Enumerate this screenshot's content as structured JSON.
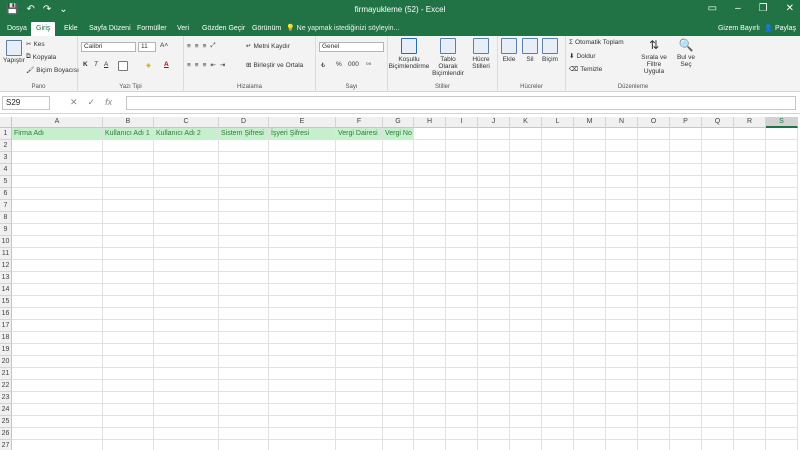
{
  "window": {
    "title": "firmayukleme (52) - Excel",
    "min": "–",
    "restore": "❐",
    "close": "✕",
    "ribbon_display": "▭"
  },
  "qat": {
    "save": "💾",
    "undo": "↶",
    "redo": "↷",
    "customize": "⌄"
  },
  "tabs": [
    "Dosya",
    "Giriş",
    "Ekle",
    "Sayfa Düzeni",
    "Formüller",
    "Veri",
    "Gözden Geçir",
    "Görünüm"
  ],
  "tell_me": "Ne yapmak istediğinizi söyleyin...",
  "user": "Gizem Bayırlı",
  "share": "Paylaş",
  "ribbon": {
    "clipboard": {
      "label": "Pano",
      "paste": "Yapıştır",
      "cut": "Kes",
      "copy": "Kopyala",
      "painter": "Biçim Boyacısı"
    },
    "font": {
      "label": "Yazı Tipi",
      "font_name": "Calibri",
      "font_size": "11",
      "bold": "K",
      "italic": "T",
      "underline": "A",
      "font_color": "A"
    },
    "alignment": {
      "label": "Hizalama",
      "wrap": "Metni Kaydır",
      "merge": "Birleştir ve Ortala"
    },
    "number": {
      "label": "Sayı",
      "format": "Genel",
      "percent": "%",
      "comma": "000"
    },
    "styles": {
      "label": "Stiller",
      "conditional": "Koşullu Biçimlendirme",
      "table": "Tablo Olarak Biçimlendir",
      "cell_styles": "Hücre Stilleri"
    },
    "cells": {
      "label": "Hücreler",
      "insert": "Ekle",
      "delete": "Sil",
      "format": "Biçim"
    },
    "editing": {
      "label": "Düzenleme",
      "autosum": "Otomatik Toplam",
      "fill": "Doldur",
      "clear": "Temizle",
      "sort": "Sırala ve Filtre Uygula",
      "find": "Bul ve Seç"
    }
  },
  "formula_bar": {
    "name_box": "S29",
    "cancel": "✕",
    "enter": "✓",
    "fx": "fx",
    "value": ""
  },
  "sheet": {
    "columns": [
      "A",
      "B",
      "C",
      "D",
      "E",
      "F",
      "G",
      "H",
      "I",
      "J",
      "K",
      "L",
      "M",
      "N",
      "O",
      "P",
      "Q",
      "R",
      "S"
    ],
    "active_column": "S",
    "row_count": 27,
    "headers": [
      "Firma Adı",
      "Kullanıcı Adı 1",
      "Kullanıcı Adı 2",
      "Sistem Şifresi",
      "İşyeri Şifresi",
      "Vergi Dairesi",
      "Vergi No"
    ]
  },
  "colors": {
    "accent": "#217346",
    "header_fill": "#c6efce",
    "header_text": "#2e7d32"
  }
}
